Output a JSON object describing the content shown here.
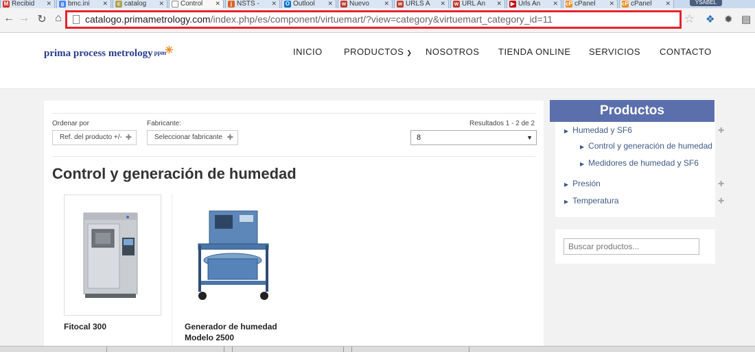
{
  "browser": {
    "tabs": [
      {
        "label": "Recibid",
        "fav": "M",
        "color": "#d93025"
      },
      {
        "label": "bmc.ini",
        "fav": "g",
        "color": "#4285f4"
      },
      {
        "label": "catalog",
        "fav": "c",
        "color": "#b0a050"
      },
      {
        "label": "Control",
        "fav": "",
        "color": "#ffffff"
      },
      {
        "label": "NSTS -",
        "fav": "j",
        "color": "#e06020"
      },
      {
        "label": "Outlool",
        "fav": "O",
        "color": "#0072c6"
      },
      {
        "label": "Nuevo",
        "fav": "w",
        "color": "#c0392b"
      },
      {
        "label": "URLS A",
        "fav": "w",
        "color": "#c0392b"
      },
      {
        "label": "URL An",
        "fav": "w",
        "color": "#c0392b"
      },
      {
        "label": "Urls An",
        "fav": "▶",
        "color": "#cc0000"
      },
      {
        "label": "cPanel",
        "fav": "cP",
        "color": "#f28c1b"
      },
      {
        "label": "cPanel",
        "fav": "cP",
        "color": "#f28c1b"
      }
    ],
    "user": "YSABEL",
    "url_host": "catalogo.primametrology.com",
    "url_path": "/index.php/es/component/virtuemart/?view=category&virtuemart_category_id=11"
  },
  "site": {
    "logo": "prima process metrology",
    "logo_ppm": "ppm",
    "nav": [
      "INICIO",
      "PRODUCTOS",
      "NOSOTROS",
      "TIENDA ONLINE",
      "SERVICIOS",
      "CONTACTO"
    ]
  },
  "filters": {
    "order_label": "Ordenar por",
    "order_button": "Ref. del producto +/-",
    "maker_label": "Fabricante:",
    "maker_button": "Seleccionar fabricante",
    "results": "Resultados 1 - 2 de 2",
    "per_page": "8"
  },
  "category_title": "Control y generación de humedad",
  "products": [
    {
      "name": "Fitocal 300"
    },
    {
      "name": "Generador de humedad",
      "name2": "Modelo 2500"
    }
  ],
  "sidebar": {
    "title": "Productos",
    "items": [
      {
        "label": "Humedad y SF6"
      },
      {
        "label": "Control y generación de humedad"
      },
      {
        "label": "Medidores de humedad y SF6"
      },
      {
        "label": "Presión"
      },
      {
        "label": "Temperatura"
      }
    ],
    "search_placeholder": "Buscar productos..."
  }
}
